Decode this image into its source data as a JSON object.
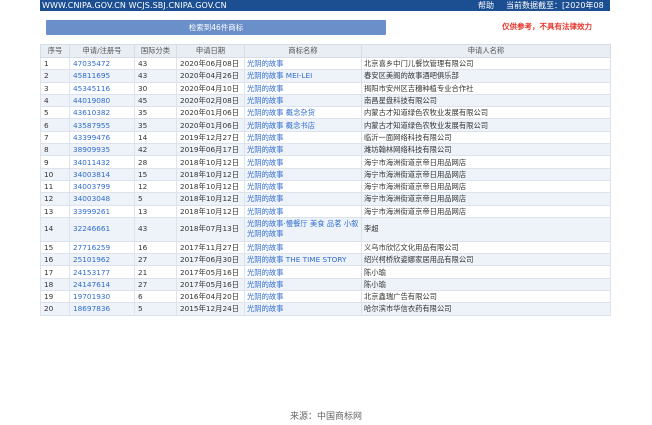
{
  "topbar": {
    "domains": "WWW.CNIPA.GOV.CN WCJS.SBJ.CNIPA.GOV.CN",
    "help": "帮助",
    "db_date": "当前数据截至：[2020年08月30日]"
  },
  "search": {
    "result_label": "检索到46件商标",
    "disclaimer": "仅供参考，不具有法律效力"
  },
  "table": {
    "headers": [
      "序号",
      "申请/注册号",
      "国际分类",
      "申请日期",
      "商标名称",
      "申请人名称"
    ],
    "rows": [
      {
        "no": "1",
        "reg": "47035472",
        "cls": "43",
        "date": "2020年06月08日",
        "name": "光阴的故事",
        "app": "北京喜乡中门儿餐饮管理有限公司"
      },
      {
        "no": "2",
        "reg": "45811695",
        "cls": "43",
        "date": "2020年04月26日",
        "name": "光阴的故事 MEI-LEI",
        "app": "春安区美阁的故事酒吧俱乐部"
      },
      {
        "no": "3",
        "reg": "45345116",
        "cls": "30",
        "date": "2020年04月10日",
        "name": "光阴的故事",
        "app": "揭阳市安州区吉穗种植专业合作社"
      },
      {
        "no": "4",
        "reg": "44019080",
        "cls": "45",
        "date": "2020年02月08日",
        "name": "光阴的故事",
        "app": "南昌星盘科技有限公司"
      },
      {
        "no": "5",
        "reg": "43610382",
        "cls": "35",
        "date": "2020年01月06日",
        "name": "光阴的故事 概念杂货",
        "app": "内蒙古才知道绿色农牧业发展有限公司"
      },
      {
        "no": "6",
        "reg": "43587955",
        "cls": "35",
        "date": "2020年01月06日",
        "name": "光阴的故事 概念书店",
        "app": "内蒙古才知道绿色农牧业发展有限公司"
      },
      {
        "no": "7",
        "reg": "43399476",
        "cls": "14",
        "date": "2019年12月27日",
        "name": "光阴的故事",
        "app": "临沂一面网络科技有限公司"
      },
      {
        "no": "8",
        "reg": "38909935",
        "cls": "42",
        "date": "2019年06月17日",
        "name": "光阴的故事",
        "app": "潍坊翰林网络科技有限公司"
      },
      {
        "no": "9",
        "reg": "34011432",
        "cls": "28",
        "date": "2018年10月12日",
        "name": "光阴的故事",
        "app": "海宁市海洲街道京帝日用品网店"
      },
      {
        "no": "10",
        "reg": "34003814",
        "cls": "15",
        "date": "2018年10月12日",
        "name": "光阴的故事",
        "app": "海宁市海洲街道京帝日用品网店"
      },
      {
        "no": "11",
        "reg": "34003799",
        "cls": "12",
        "date": "2018年10月12日",
        "name": "光阴的故事",
        "app": "海宁市海洲街道京帝日用品网店"
      },
      {
        "no": "12",
        "reg": "34003048",
        "cls": "5",
        "date": "2018年10月12日",
        "name": "光阴的故事",
        "app": "海宁市海洲街道京帝日用品网店"
      },
      {
        "no": "13",
        "reg": "33999261",
        "cls": "13",
        "date": "2018年10月12日",
        "name": "光阴的故事",
        "app": "海宁市海洲街道京帝日用品网店"
      },
      {
        "no": "14",
        "reg": "32246661",
        "cls": "43",
        "date": "2018年07月13日",
        "name": "光阴的故事·慢餐厅 美食 品茗 小叙 光阴的故事",
        "app": "李超"
      },
      {
        "no": "15",
        "reg": "27716259",
        "cls": "16",
        "date": "2017年11月27日",
        "name": "光阴的故事",
        "app": "义乌市欣忆文化用品有限公司"
      },
      {
        "no": "16",
        "reg": "25101962",
        "cls": "27",
        "date": "2017年06月30日",
        "name": "光阴的故事 THE TIME STORY",
        "app": "绍兴柯桥欣姿娜家居用品有限公司"
      },
      {
        "no": "17",
        "reg": "24153177",
        "cls": "21",
        "date": "2017年05月16日",
        "name": "光阴的故事",
        "app": "陈小瑜"
      },
      {
        "no": "18",
        "reg": "24147614",
        "cls": "27",
        "date": "2017年05月16日",
        "name": "光阴的故事",
        "app": "陈小瑜"
      },
      {
        "no": "19",
        "reg": "19701930",
        "cls": "6",
        "date": "2016年04月20日",
        "name": "光阴的故事",
        "app": "北京鑫瑞广告有限公司"
      },
      {
        "no": "20",
        "reg": "18697836",
        "cls": "5",
        "date": "2015年12月24日",
        "name": "光阴的故事",
        "app": "哈尔滨市华信衣药有限公司"
      }
    ]
  },
  "footer": {
    "source": "来源：中国商标网"
  }
}
